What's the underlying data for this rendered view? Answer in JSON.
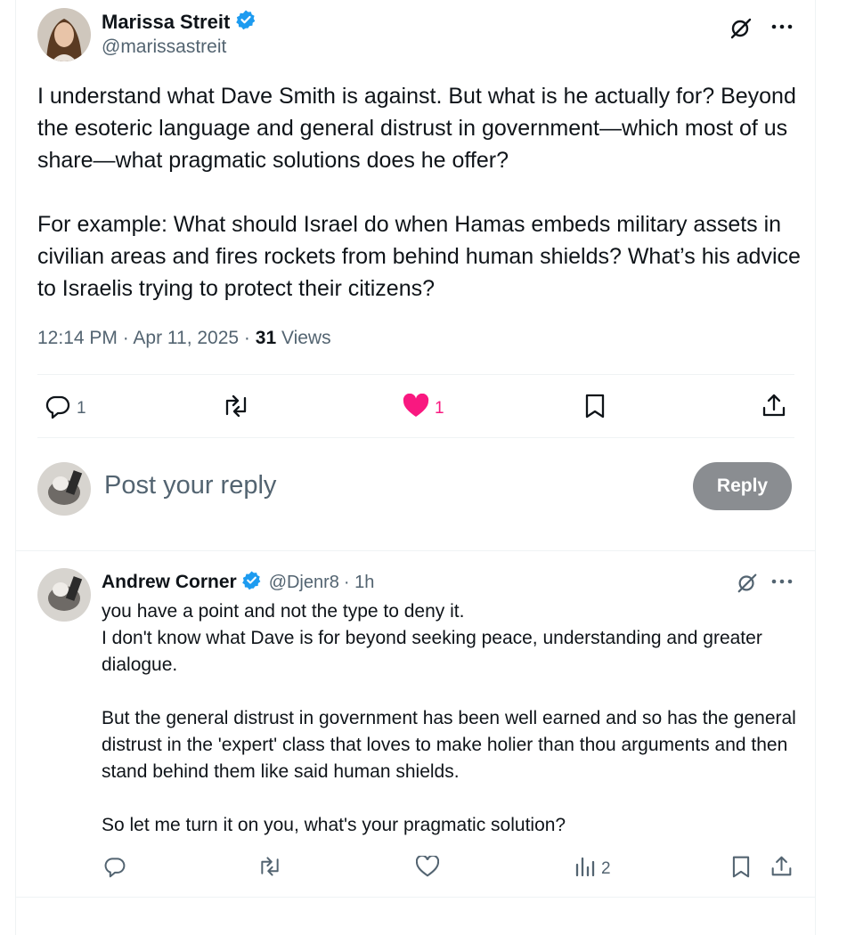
{
  "post": {
    "author_name": "Marissa Streit",
    "handle": "@marissastreit",
    "body": "I understand what Dave Smith is against. But what is he actually for? Beyond the esoteric language and general distrust in government—which most of us share—what pragmatic solutions does he offer?\n\nFor example: What should Israel do when Hamas embeds military assets in civilian areas and fires rockets from behind human shields? What’s his advice to Israelis trying to protect their citizens?",
    "time": "12:14 PM · Apr 11, 2025 · ",
    "views_count": "31",
    "views_label": " Views",
    "replies": "1",
    "likes": "1"
  },
  "composer": {
    "placeholder": "Post your reply",
    "reply_button": "Reply"
  },
  "reply": {
    "author_name": "Andrew Corner",
    "handle": "@Djenr8",
    "age": "· 1h",
    "body": "you have a point and not the type to deny it.\nI don't know what Dave is for beyond seeking peace, understanding and greater dialogue.\n\nBut the general distrust in government has been well earned and so has the general distrust in the 'expert' class that loves to make holier than thou arguments and then stand behind them like said human shields.\n\nSo let me turn it on you, what's your pragmatic solution?",
    "views": "2"
  },
  "colors": {
    "accent": "#1d9bf0",
    "like": "#f91880",
    "muted": "#536471",
    "reply_button_bg": "#8a8d91"
  },
  "icons": [
    "grok-icon",
    "more-icon",
    "reply-icon",
    "retweet-icon",
    "heart-icon",
    "bookmark-icon",
    "share-icon",
    "views-icon",
    "verified-badge-icon"
  ]
}
